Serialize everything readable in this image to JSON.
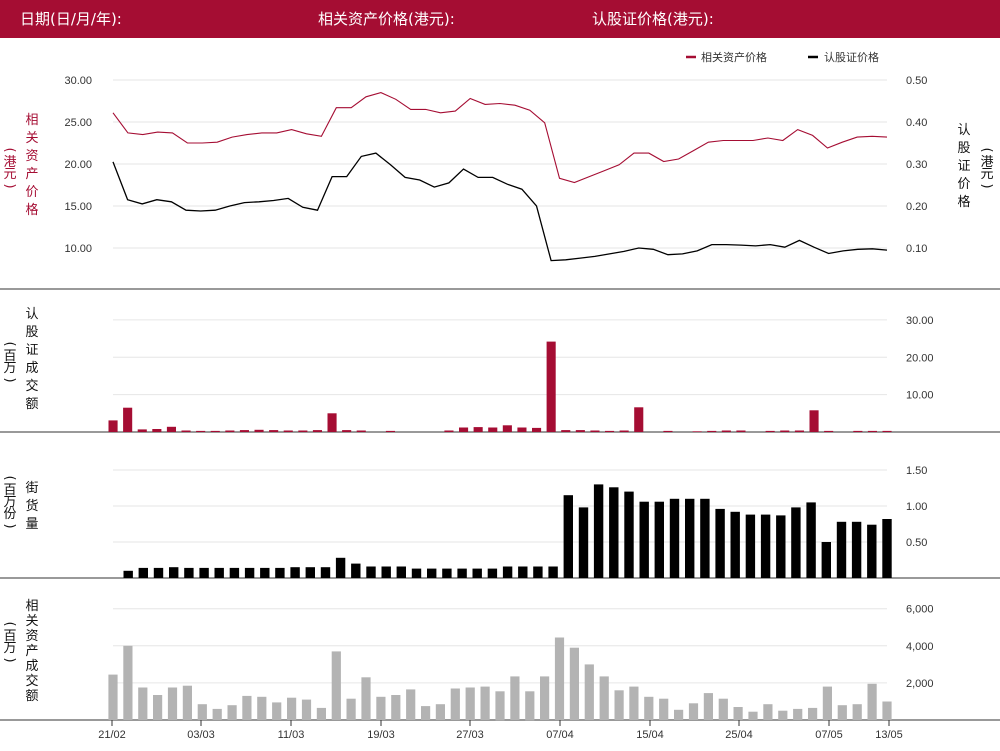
{
  "header": {
    "date_label": "日期(日/月/年):",
    "underlying_label": "相关资产价格(港元):",
    "warrant_label": "认股证价格(港元):"
  },
  "colors": {
    "header_bg": "#a50d33",
    "underlying": "#a50d33",
    "warrant": "#000000",
    "turnover_bar": "#a50d33",
    "outstanding_bar": "#000000",
    "underlying_turnover_bar": "#b3b3b3"
  },
  "chart_data": [
    {
      "type": "line",
      "legend": [
        "相关资产价格",
        "认股证价格"
      ],
      "legend_position": "top-right",
      "ylabel_left": "相关资产价格（港元）",
      "ylabel_right": "认股证价格（港元）",
      "yticks_left": [
        "30.00",
        "25.00",
        "20.00",
        "15.00",
        "10.00"
      ],
      "yticks_right": [
        "0.50",
        "0.40",
        "0.30",
        "0.20",
        "0.10"
      ],
      "ylim_left": [
        7.5,
        31.5
      ],
      "ylim_right": [
        0.05,
        0.53
      ],
      "series": [
        {
          "name": "相关资产价格",
          "axis": "left",
          "values": [
            26.1,
            23.7,
            23.5,
            23.8,
            23.7,
            22.5,
            22.5,
            22.6,
            23.2,
            23.5,
            23.7,
            23.7,
            24.1,
            23.6,
            23.3,
            26.7,
            26.7,
            28.0,
            28.5,
            27.7,
            26.5,
            26.5,
            26.1,
            26.3,
            27.8,
            27.1,
            27.2,
            27.0,
            26.4,
            24.9,
            18.3,
            17.8,
            18.5,
            19.2,
            19.9,
            21.3,
            21.3,
            20.3,
            20.6,
            21.6,
            22.6,
            22.8,
            22.8,
            22.8,
            23.1,
            22.8,
            24.1,
            23.4,
            21.9,
            22.6,
            23.2,
            23.3,
            23.2
          ]
        },
        {
          "name": "认股证价格",
          "axis": "right",
          "values": [
            0.305,
            0.215,
            0.205,
            0.215,
            0.21,
            0.19,
            0.188,
            0.19,
            0.2,
            0.208,
            0.21,
            0.213,
            0.218,
            0.197,
            0.19,
            0.27,
            0.27,
            0.318,
            0.326,
            0.298,
            0.268,
            0.262,
            0.245,
            0.255,
            0.288,
            0.268,
            0.268,
            0.252,
            0.24,
            0.2,
            0.07,
            0.072,
            0.076,
            0.08,
            0.086,
            0.092,
            0.1,
            0.097,
            0.084,
            0.086,
            0.093,
            0.108,
            0.108,
            0.107,
            0.105,
            0.108,
            0.102,
            0.118,
            0.102,
            0.087,
            0.093,
            0.097,
            0.098,
            0.095
          ]
        }
      ]
    },
    {
      "type": "bar",
      "ylabel_left": "认股证成交额（百万）",
      "yticks_right": [
        "30.00",
        "20.00",
        "10.00"
      ],
      "ylim": [
        0,
        33
      ],
      "values": [
        3.1,
        6.5,
        0.7,
        0.8,
        1.4,
        0.4,
        0.3,
        0.3,
        0.4,
        0.5,
        0.6,
        0.5,
        0.4,
        0.4,
        0.5,
        5.0,
        0.5,
        0.4,
        0,
        0.3,
        0,
        0,
        0,
        0.4,
        1.2,
        1.3,
        1.2,
        1.8,
        1.2,
        1.1,
        24.2,
        0.5,
        0.5,
        0.4,
        0.3,
        0.4,
        6.6,
        0,
        0.3,
        0,
        0.2,
        0.3,
        0.4,
        0.4,
        0,
        0.3,
        0.4,
        0.4,
        5.8,
        0.3,
        0,
        0.3,
        0.3,
        0.3
      ]
    },
    {
      "type": "bar",
      "ylabel_left": "街货量（百万份）",
      "yticks_right": [
        "1.50",
        "1.00",
        "0.50"
      ],
      "ylim": [
        0,
        1.5
      ],
      "values": [
        0,
        0.1,
        0.14,
        0.14,
        0.15,
        0.14,
        0.14,
        0.14,
        0.14,
        0.14,
        0.14,
        0.14,
        0.15,
        0.15,
        0.15,
        0.28,
        0.2,
        0.16,
        0.16,
        0.16,
        0.13,
        0.13,
        0.13,
        0.13,
        0.13,
        0.13,
        0.16,
        0.16,
        0.16,
        0.16,
        1.15,
        0.98,
        1.3,
        1.26,
        1.2,
        1.06,
        1.06,
        1.1,
        1.1,
        1.1,
        0.96,
        0.92,
        0.88,
        0.88,
        0.87,
        0.98,
        1.05,
        0.5,
        0.78,
        0.78,
        0.74,
        0.82
      ]
    },
    {
      "type": "bar",
      "ylabel_left": "相关资产成交额（百万）",
      "yticks_right": [
        "6,000",
        "4,000",
        "2,000"
      ],
      "ylim": [
        0,
        6200
      ],
      "categories": [
        "21/02",
        "03/03",
        "11/03",
        "19/03",
        "27/03",
        "07/04",
        "15/04",
        "25/04",
        "07/05",
        "13/05"
      ],
      "values": [
        2450,
        4000,
        1750,
        1350,
        1750,
        1850,
        850,
        600,
        800,
        1300,
        1250,
        950,
        1200,
        1100,
        650,
        3700,
        1150,
        2300,
        1250,
        1350,
        1650,
        750,
        850,
        1700,
        1750,
        1800,
        1550,
        2350,
        1550,
        2350,
        4450,
        3900,
        3000,
        2350,
        1600,
        1800,
        1250,
        1150,
        550,
        900,
        1450,
        1150,
        700,
        450,
        850,
        500,
        600,
        650,
        1800,
        800,
        850,
        1950,
        1000
      ]
    }
  ]
}
